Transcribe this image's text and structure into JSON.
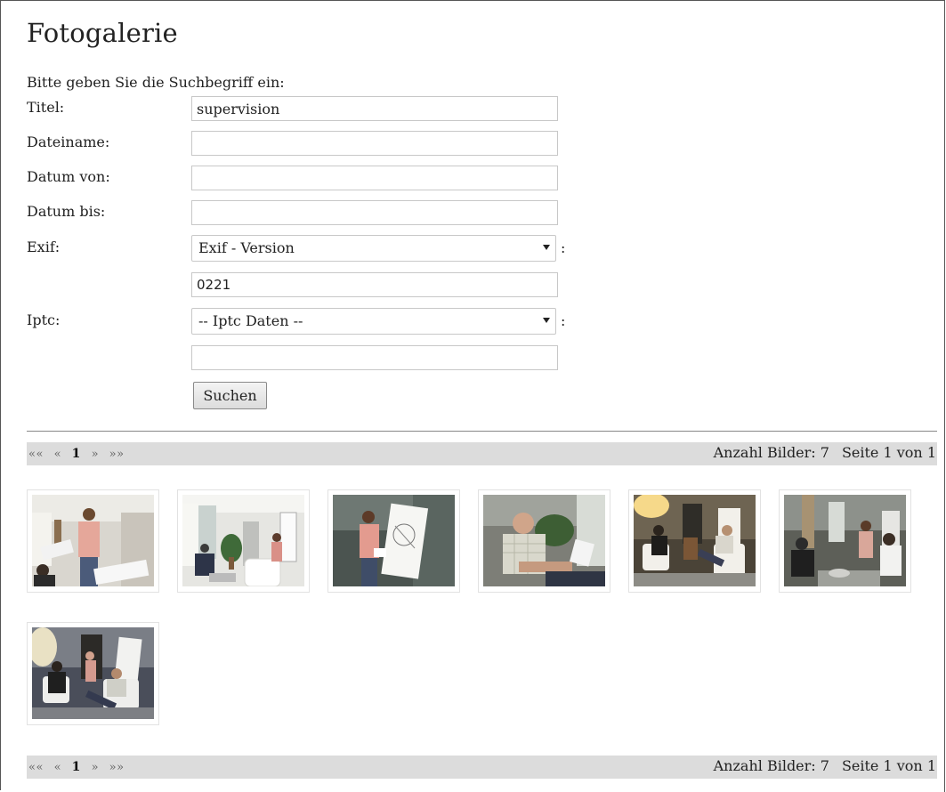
{
  "page": {
    "title": "Fotogalerie"
  },
  "form": {
    "intro": "Bitte geben Sie die Suchbegriff ein:",
    "titel_label": "Titel:",
    "titel_value": "supervision",
    "dateiname_label": "Dateiname:",
    "dateiname_value": "",
    "datum_von_label": "Datum von:",
    "datum_von_value": "",
    "datum_bis_label": "Datum bis:",
    "datum_bis_value": "",
    "exif_label": "Exif:",
    "exif_select": "Exif - Version",
    "exif_value": "0221",
    "iptc_label": "Iptc:",
    "iptc_select": "-- Iptc Daten --",
    "iptc_value": "",
    "colon": ":",
    "submit_label": "Suchen"
  },
  "pager": {
    "first": "««",
    "prev": "«",
    "current": "1",
    "next": "»",
    "last": "»»",
    "count_text": "Anzahl Bilder: 7",
    "page_text": "Seite 1 von 1"
  },
  "gallery": {
    "images": [
      {
        "name": "photo-1",
        "scene": "woman standing with papers, person seated left"
      },
      {
        "name": "photo-2",
        "scene": "room with plant, white armchair, person at flipchart"
      },
      {
        "name": "photo-3",
        "scene": "woman presenting at flipchart"
      },
      {
        "name": "photo-4",
        "scene": "bald man in checked shirt seated"
      },
      {
        "name": "photo-5",
        "scene": "two people seated in lit room"
      },
      {
        "name": "photo-6",
        "scene": "group of people seated and standing"
      },
      {
        "name": "photo-7",
        "scene": "two seated people, one standing at back"
      }
    ]
  },
  "colors": {
    "pager_bg": "#dcdcdc",
    "field_border": "#c8c8c8",
    "text": "#222222"
  }
}
